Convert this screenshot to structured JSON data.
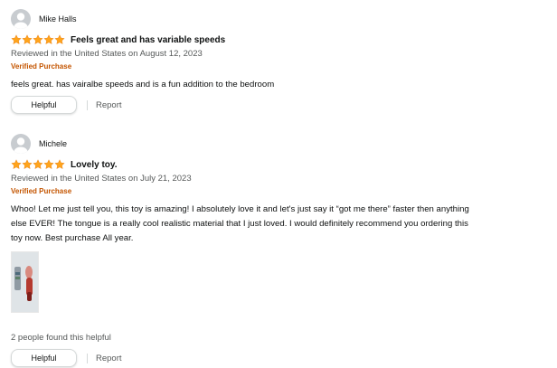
{
  "reviews": [
    {
      "reviewer": "Mike Halls",
      "rating": 5,
      "title": "Feels great and has variable speeds",
      "date_line": "Reviewed in the United States on August 12, 2023",
      "verified": "Verified Purchase",
      "body": "feels great. has vairalbe speeds and is a fun addition to the bedroom",
      "helpful_label": "Helpful",
      "report_label": "Report"
    },
    {
      "reviewer": "Michele",
      "rating": 5,
      "title": "Lovely toy.",
      "date_line": "Reviewed in the United States on July 21, 2023",
      "verified": "Verified Purchase",
      "body": "Whoo! Let me just tell you, this toy is amazing! I absolutely love it and let's just say it “got me there” faster then anything else EVER! The tongue is a really cool realistic material that I just loved. I would definitely recommend you ordering this toy now. Best purchase All year.",
      "helpful_count": "2 people found this helpful",
      "helpful_label": "Helpful",
      "report_label": "Report"
    }
  ],
  "colors": {
    "star": "#ffa41c",
    "verified": "#c45500",
    "muted_text": "#565959",
    "button_border": "#d5d9d9"
  }
}
